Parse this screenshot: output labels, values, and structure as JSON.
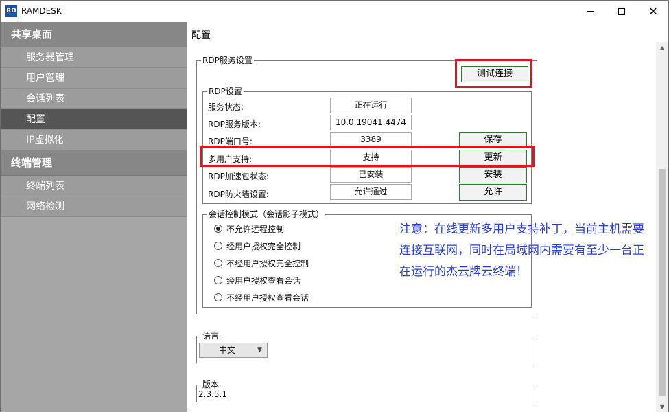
{
  "window": {
    "logo_text": "RD",
    "title": "RAMDESK",
    "minimize_icon": "minimize-icon",
    "maximize_icon": "maximize-icon",
    "close_icon": "close-icon"
  },
  "sidebar": {
    "groups": [
      {
        "label": "共享桌面",
        "items": [
          "服务器管理",
          "用户管理",
          "会话列表",
          "配置",
          "IP虚拟化"
        ]
      },
      {
        "label": "终端管理",
        "items": [
          "终端列表",
          "网络检测"
        ]
      }
    ],
    "active_item": "配置"
  },
  "main": {
    "title": "配置",
    "rdp_service": {
      "legend": "RDP服务设置",
      "test_button": "测试连接",
      "rdp_settings": {
        "legend": "RDP设置",
        "rows": [
          {
            "label": "服务状态:",
            "value": "正在运行",
            "button": ""
          },
          {
            "label": "RDP服务版本:",
            "value": "10.0.19041.4474",
            "button": ""
          },
          {
            "label": "RDP端口号:",
            "value": "3389",
            "button": "保存"
          },
          {
            "label": "多用户支持:",
            "value": "支持",
            "button": "更新"
          },
          {
            "label": "RDP加速包状态:",
            "value": "已安装",
            "button": "安装"
          },
          {
            "label": "RDP防火墙设置:",
            "value": "允许通过",
            "button": "允许"
          }
        ]
      },
      "session_control": {
        "legend": "会话控制模式（会话影子模式）",
        "options": [
          "不允许远程控制",
          "经用户授权完全控制",
          "不经用户授权完全控制",
          "经用户授权查看会话",
          "不经用户授权查看会话"
        ],
        "selected_index": 0
      },
      "note": "注意：在线更新多用户支持补丁，当前主机需要连接互联网，同时在局域网内需要有至少一台正在运行的杰云牌云终端！"
    },
    "language": {
      "legend": "语言",
      "selected": "中文"
    },
    "version": {
      "legend": "版本",
      "value": "2.3.5.1"
    }
  },
  "colors": {
    "sidebar_bg": "#a6a6a6",
    "sidebar_group_bg": "#878787",
    "sidebar_active_bg": "#555555",
    "highlight_red": "#e0141e",
    "note_blue": "#2a3ed0",
    "button_border_green": "#2e7d2e"
  }
}
